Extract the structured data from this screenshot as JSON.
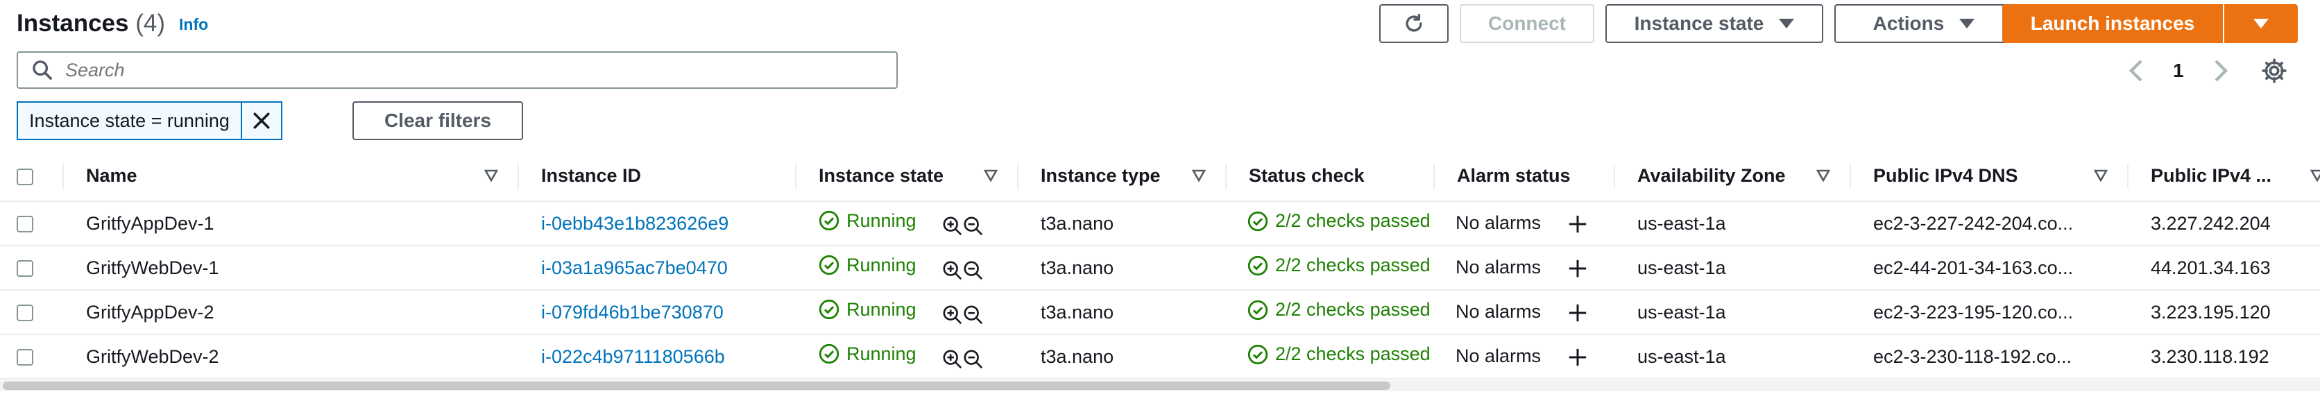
{
  "header": {
    "title": "Instances",
    "count": "(4)",
    "info_label": "Info"
  },
  "toolbar": {
    "refresh_icon": "refresh-icon",
    "connect_label": "Connect",
    "instance_state_label": "Instance state",
    "actions_label": "Actions",
    "launch_label": "Launch instances"
  },
  "search": {
    "placeholder": "Search"
  },
  "filter": {
    "token_label": "Instance state = running",
    "clear_label": "Clear filters"
  },
  "pagination": {
    "current_page": "1"
  },
  "table": {
    "columns": [
      "Name",
      "Instance ID",
      "Instance state",
      "Instance type",
      "Status check",
      "Alarm status",
      "Availability Zone",
      "Public IPv4 DNS",
      "Public IPv4 ..."
    ],
    "rows": [
      {
        "name": "GritfyAppDev-1",
        "id": "i-0ebb43e1b823626e9",
        "state": "Running",
        "type": "t3a.nano",
        "status": "2/2 checks passed",
        "alarm": "No alarms",
        "az": "us-east-1a",
        "dns": "ec2-3-227-242-204.co...",
        "ip": "3.227.242.204"
      },
      {
        "name": "GritfyWebDev-1",
        "id": "i-03a1a965ac7be0470",
        "state": "Running",
        "type": "t3a.nano",
        "status": "2/2 checks passed",
        "alarm": "No alarms",
        "az": "us-east-1a",
        "dns": "ec2-44-201-34-163.co...",
        "ip": "44.201.34.163"
      },
      {
        "name": "GritfyAppDev-2",
        "id": "i-079fd46b1be730870",
        "state": "Running",
        "type": "t3a.nano",
        "status": "2/2 checks passed",
        "alarm": "No alarms",
        "az": "us-east-1a",
        "dns": "ec2-3-223-195-120.co...",
        "ip": "3.223.195.120"
      },
      {
        "name": "GritfyWebDev-2",
        "id": "i-022c4b9711180566b",
        "state": "Running",
        "type": "t3a.nano",
        "status": "2/2 checks passed",
        "alarm": "No alarms",
        "az": "us-east-1a",
        "dns": "ec2-3-230-118-192.co...",
        "ip": "3.230.118.192"
      }
    ]
  },
  "colors": {
    "accent": "#ec7211",
    "link": "#0073bb",
    "success": "#1d8102"
  }
}
